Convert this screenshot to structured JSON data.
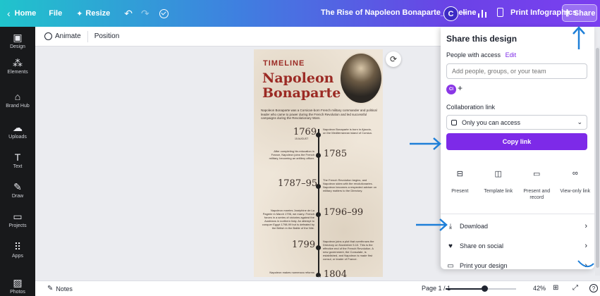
{
  "topbar": {
    "home_label": "Home",
    "file_label": "File",
    "resize_label": "Resize",
    "title": "The Rise of Napoleon Bonaparte_Timeline",
    "avatar_initial": "C",
    "print_label": "Print Infographics",
    "share_label": "Share"
  },
  "leftrail": {
    "items": [
      {
        "label": "Design",
        "icon": "design-icon"
      },
      {
        "label": "Elements",
        "icon": "elements-icon"
      },
      {
        "label": "Brand Hub",
        "icon": "brand-hub-icon"
      },
      {
        "label": "Uploads",
        "icon": "uploads-icon"
      },
      {
        "label": "Text",
        "icon": "text-icon"
      },
      {
        "label": "Draw",
        "icon": "draw-icon"
      },
      {
        "label": "Projects",
        "icon": "projects-icon"
      },
      {
        "label": "Apps",
        "icon": "apps-icon"
      },
      {
        "label": "Photos",
        "icon": "photos-icon"
      }
    ]
  },
  "subbar": {
    "animate_label": "Animate",
    "position_label": "Position"
  },
  "design": {
    "heading": "TIMELINE",
    "name_line1": "Napoleon",
    "name_line2": "Bonaparte",
    "intro": "Napoleon Bonaparte was a Corsican-born French military commander and political leader who came to power during the French Revolution and led successful campaigns during the Revolutionary Wars.",
    "events": [
      {
        "year": "1769",
        "sub": "15 AUGUST",
        "note": "Napoleon Bonaparte is born in Ajaccio, on the Mediterranean island of Corsica."
      },
      {
        "year": "1785",
        "sub": "",
        "note": "After completing his education in France, Napoleon joins the French military, becoming an artillery officer."
      },
      {
        "year": "1787–95",
        "sub": "",
        "note": "The French Revolution begins, and Napoleon sides with the revolutionaries. Napoleon becomes a respected adviser on military matters to the Directory."
      },
      {
        "year": "1796–99",
        "sub": "",
        "note": "Napoleon marries Joséphine de La Pagerie in March 1796, we marry. French forces in a series of victories against the Austrians in northern Italy. An attempt to conquer Egypt 1798-99 but is defeated by the British in the Battle of the Nile."
      },
      {
        "year": "1799",
        "sub": "",
        "note": "Napoleon joins a plot that overthrows the Directory on November 9-10. This is the effective end of the French Revolution. A new government, the Consulate, is established, and Napoleon is made first consul, or leader of France."
      },
      {
        "year": "1804",
        "sub": "",
        "note": "Napoleon makes numerous reforms"
      }
    ]
  },
  "share": {
    "title": "Share this design",
    "people_label": "People with access",
    "edit_label": "Edit",
    "input_placeholder": "Add people, groups, or your team",
    "member_initials": "CI",
    "collab_label": "Collaboration link",
    "access_value": "Only you can access",
    "copy_label": "Copy link",
    "options": [
      {
        "label": "Present",
        "icon": "present-icon"
      },
      {
        "label": "Template link",
        "icon": "template-link-icon"
      },
      {
        "label": "Present and record",
        "icon": "present-record-icon"
      },
      {
        "label": "View-only link",
        "icon": "view-only-link-icon"
      }
    ],
    "rows": [
      {
        "label": "Download",
        "icon": "download-icon"
      },
      {
        "label": "Share on social",
        "icon": "share-social-icon"
      },
      {
        "label": "Print your design",
        "icon": "print-icon"
      }
    ]
  },
  "bottombar": {
    "notes_label": "Notes",
    "page_label": "Page 1 / 1",
    "zoom_value": "42%",
    "zoom_fraction": 0.42
  },
  "colors": {
    "accent": "#7d2ae8",
    "annotation_arrow": "#1e7fd8",
    "rail": "#18191b",
    "title_red": "#9b2a24"
  }
}
